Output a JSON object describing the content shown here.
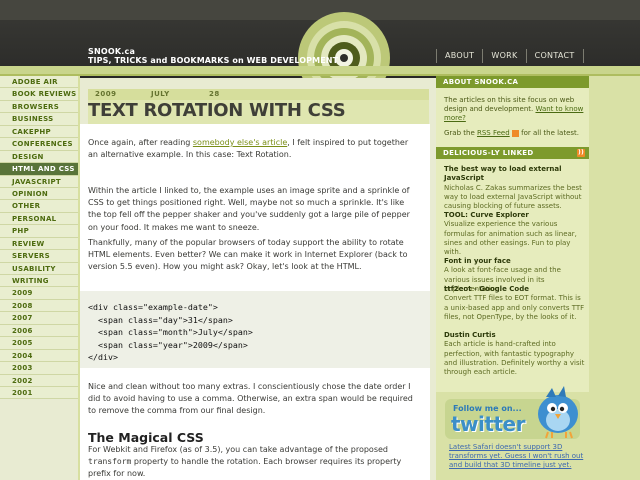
{
  "site": {
    "name": "SNOOK.ca",
    "tagline": "TIPS, TRICKS and BOOKMARKS on WEB DEVELOPMENT"
  },
  "nav": {
    "about": "ABOUT",
    "work": "WORK",
    "contact": "CONTACT"
  },
  "categories": [
    "ADOBE AIR",
    "BOOK REVIEWS",
    "BROWSERS",
    "BUSINESS",
    "CAKEPHP",
    "CONFERENCES",
    "DESIGN",
    "HTML AND CSS",
    "JAVASCRIPT",
    "OPINION",
    "OTHER",
    "PERSONAL",
    "PHP",
    "REVIEW",
    "SERVERS",
    "USABILITY",
    "WRITING",
    "2009",
    "2008",
    "2007",
    "2006",
    "2005",
    "2004",
    "2003",
    "2002",
    "2001"
  ],
  "active_category": "HTML AND CSS",
  "post": {
    "year": "2009",
    "month": "JULY",
    "day": "28",
    "title": "TEXT ROTATION WITH CSS",
    "p1_before": "Once again, after reading ",
    "p1_link": "somebody else's article",
    "p1_after": ", I felt inspired to put together an alternative example. In this case: Text Rotation.",
    "p2": "Within the article I linked to, the example uses an image sprite and a sprinkle of CSS to get things positioned right. Well, maybe not so much a sprinkle. It's like the top fell off the pepper shaker and you've suddenly got a large pile of pepper on your food. It makes me want to sneeze.",
    "p3": "Thankfully, many of the popular browsers of today support the ability to rotate HTML elements. Even better? We can make it work in Internet Explorer (back to version 5.5 even). How you might ask? Okay, let's look at the HTML.",
    "code": "<div class=\"example-date\">\n  <span class=\"day\">31</span>\n  <span class=\"month\">July</span>\n  <span class=\"year\">2009</span>\n</div>",
    "p4": "Nice and clean without too many extras. I conscientiously chose the date order I did to avoid having to use a comma. Otherwise, an extra span would be required to remove the comma from our final design.",
    "h2": "The Magical CSS",
    "p5_before": "For Webkit and Firefox (as of 3.5), you can take advantage of the proposed ",
    "p5_code": "transform",
    "p5_after": " property to handle the rotation. Each browser requires its property prefix for now."
  },
  "sidebar": {
    "about_heading": "ABOUT SNOOK.CA",
    "about_text": "The articles on this site focus on web design and development. ",
    "about_link": "Want to know more?",
    "grab_before": "Grab the ",
    "grab_link": "RSS Feed",
    "grab_after": " for all the latest.",
    "delicious_heading": "DELICIOUS-LY LINKED",
    "links": [
      {
        "title": "The best way to load external JavaScript",
        "desc": "Nicholas C. Zakas summarizes the best way to load external JavaScript without causing blocking of future assets."
      },
      {
        "title": "TOOL: Curve Explorer",
        "desc": "Visualize experience the various formulas for animation such as linear, sines and other easings. Fun to play with."
      },
      {
        "title": "Font in your face",
        "desc": "A look at font-face usage and the various issues involved in its implementation."
      },
      {
        "title": "ttf2eot - Google Code",
        "desc": "Convert TTF files to EOT format. This is a unix-based app and only converts TTF files, not OpenType, by the looks of it."
      },
      {
        "title": "Dustin Curtis",
        "desc": "Each article is hand-crafted into perfection, with fantastic typography and illustration. Definitely worthy a visit through each article."
      }
    ],
    "twitter_follow": "Follow me on...",
    "twitter_logo": "twitter",
    "tweet": "Latest Safari doesn't support 3D transforms yet. Guess I won't rush out and build that 3D timeline just yet."
  },
  "colors": {
    "header_bg": "#2e2e2b",
    "accent_green": "#7d9a2c",
    "active_cat": "#59743a",
    "link": "#7a8e17"
  }
}
